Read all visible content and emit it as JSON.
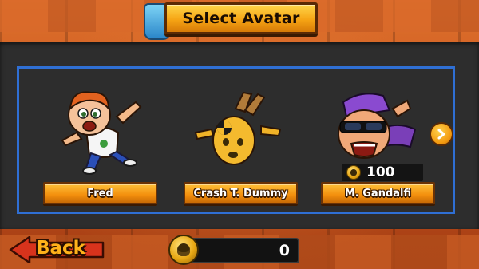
{
  "header": {
    "title": "Select Avatar"
  },
  "avatars": [
    {
      "name": "Fred",
      "locked": false
    },
    {
      "name": "Crash T. Dummy",
      "locked": false
    },
    {
      "name": "M. Gandalfi",
      "locked": true,
      "price": "100"
    }
  ],
  "footer": {
    "back_label": "Back",
    "coin_count": "0"
  },
  "icons": {
    "next": "chevron-right-icon",
    "currency": "skull-coin-icon"
  },
  "colors": {
    "accent_orange": "#f6a414",
    "frame_blue": "#2f6fd4",
    "back_red": "#d8331c",
    "panel": "#2d2d2d"
  }
}
